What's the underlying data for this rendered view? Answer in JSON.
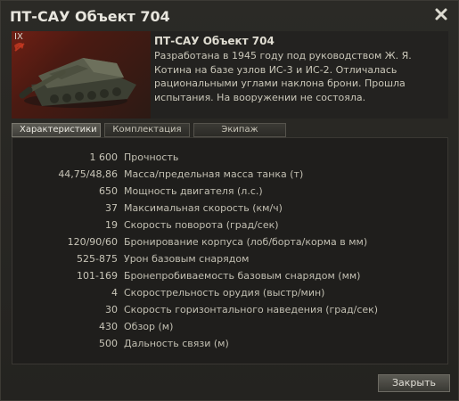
{
  "window": {
    "title": "ПТ-САУ Объект 704",
    "close_glyph": "✖"
  },
  "header": {
    "tier": "IX",
    "name": "ПТ-САУ Объект 704",
    "description": "Разработана в 1945 году под руководством Ж. Я. Котина на базе узлов ИС-3 и ИС-2. Отличалась рациональными углами наклона брони. Прошла испытания. На вооружении не состояла."
  },
  "tabs": [
    {
      "label": "Характеристики",
      "active": true
    },
    {
      "label": "Комплектация",
      "active": false
    },
    {
      "label": "Экипаж",
      "active": false
    }
  ],
  "stats": [
    {
      "value": "1 600",
      "label": "Прочность"
    },
    {
      "value": "44,75/48,86",
      "label": "Масса/предельная масса танка (т)"
    },
    {
      "value": "650",
      "label": "Мощность двигателя (л.с.)"
    },
    {
      "value": "37",
      "label": "Максимальная скорость (км/ч)"
    },
    {
      "value": "19",
      "label": "Скорость поворота (град/сек)"
    },
    {
      "value": "120/90/60",
      "label": "Бронирование корпуса (лоб/борта/корма в мм)"
    },
    {
      "value": "525-875",
      "label": "Урон базовым снарядом"
    },
    {
      "value": "101-169",
      "label": "Бронепробиваемость базовым снарядом (мм)"
    },
    {
      "value": "4",
      "label": "Скорострельность орудия (выстр/мин)"
    },
    {
      "value": "30",
      "label": "Скорость горизонтального наведения (град/сек)"
    },
    {
      "value": "430",
      "label": "Обзор (м)"
    },
    {
      "value": "500",
      "label": "Дальность связи (м)"
    }
  ],
  "footer": {
    "close_label": "Закрыть"
  },
  "colors": {
    "window_bg": "#2b2a26",
    "portrait_flag": "#6e1f14",
    "text": "#c8c5b8"
  }
}
